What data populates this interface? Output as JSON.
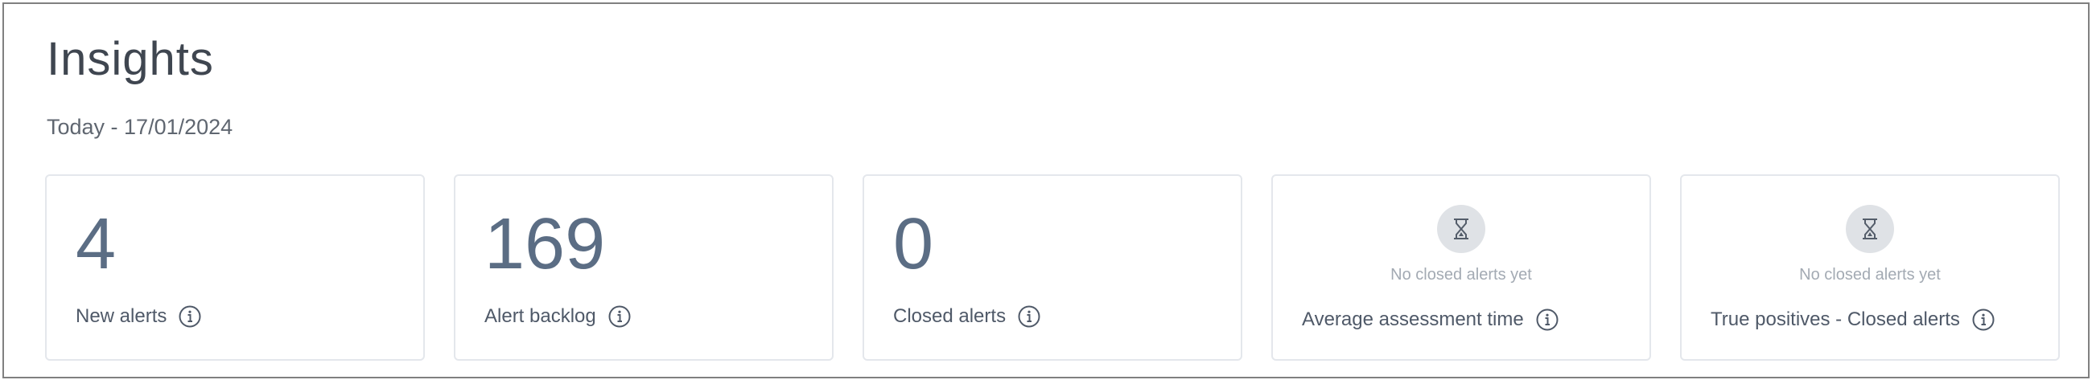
{
  "page": {
    "title": "Insights",
    "date_range": "Today - 17/01/2024"
  },
  "cards": [
    {
      "value": "4",
      "label": "New alerts",
      "info_icon": "info-icon"
    },
    {
      "value": "169",
      "label": "Alert backlog",
      "info_icon": "info-icon"
    },
    {
      "value": "0",
      "label": "Closed alerts",
      "info_icon": "info-icon"
    },
    {
      "empty_icon": "hourglass-icon",
      "empty_text": "No closed alerts yet",
      "label": "Average assessment time",
      "info_icon": "info-icon"
    },
    {
      "empty_icon": "hourglass-icon",
      "empty_text": "No closed alerts yet",
      "label": "True positives - Closed alerts",
      "info_icon": "info-icon"
    }
  ],
  "colors": {
    "title": "#3f4650",
    "value": "#5b6d84",
    "label": "#4f5968",
    "muted": "#a3aab3",
    "card_border": "#e4e7ec",
    "icon_bg": "#dfe2e6"
  }
}
